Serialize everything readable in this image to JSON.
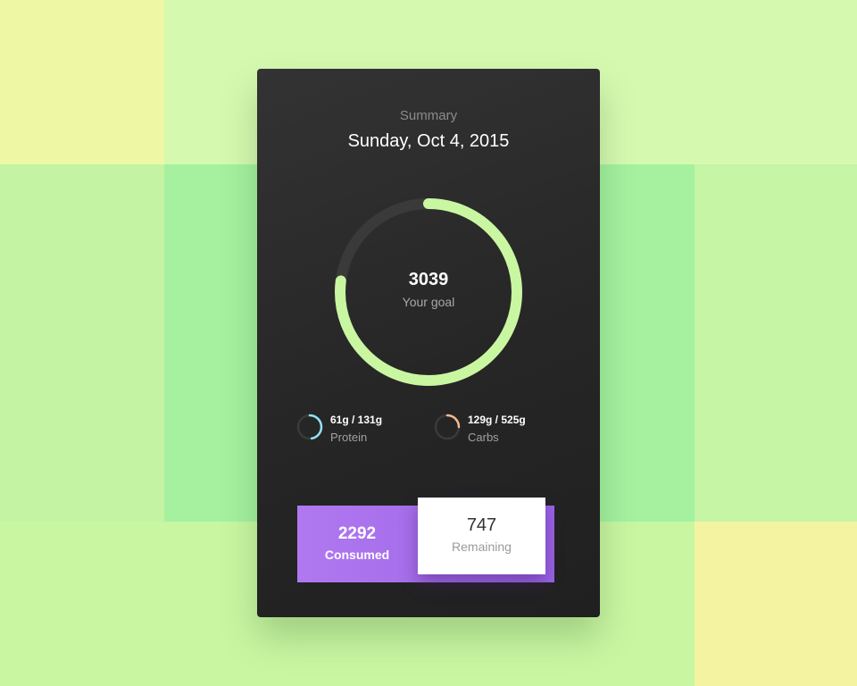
{
  "summary": {
    "label": "Summary",
    "date": "Sunday, Oct 4, 2015"
  },
  "goal": {
    "value": "3039",
    "label": "Your goal",
    "progress_fraction": 0.77,
    "color": "#c9f7a1"
  },
  "macros": [
    {
      "name": "protein",
      "value": "61g / 131g",
      "label": "Protein",
      "progress_fraction": 0.47,
      "color": "#8fe3f5"
    },
    {
      "name": "carbs",
      "value": "129g / 525g",
      "label": "Carbs",
      "progress_fraction": 0.25,
      "color": "#f2b991"
    }
  ],
  "consumed": {
    "value": "2292",
    "label": "Consumed",
    "color": "#a56cea"
  },
  "remaining": {
    "value": "747",
    "label": "Remaining"
  }
}
